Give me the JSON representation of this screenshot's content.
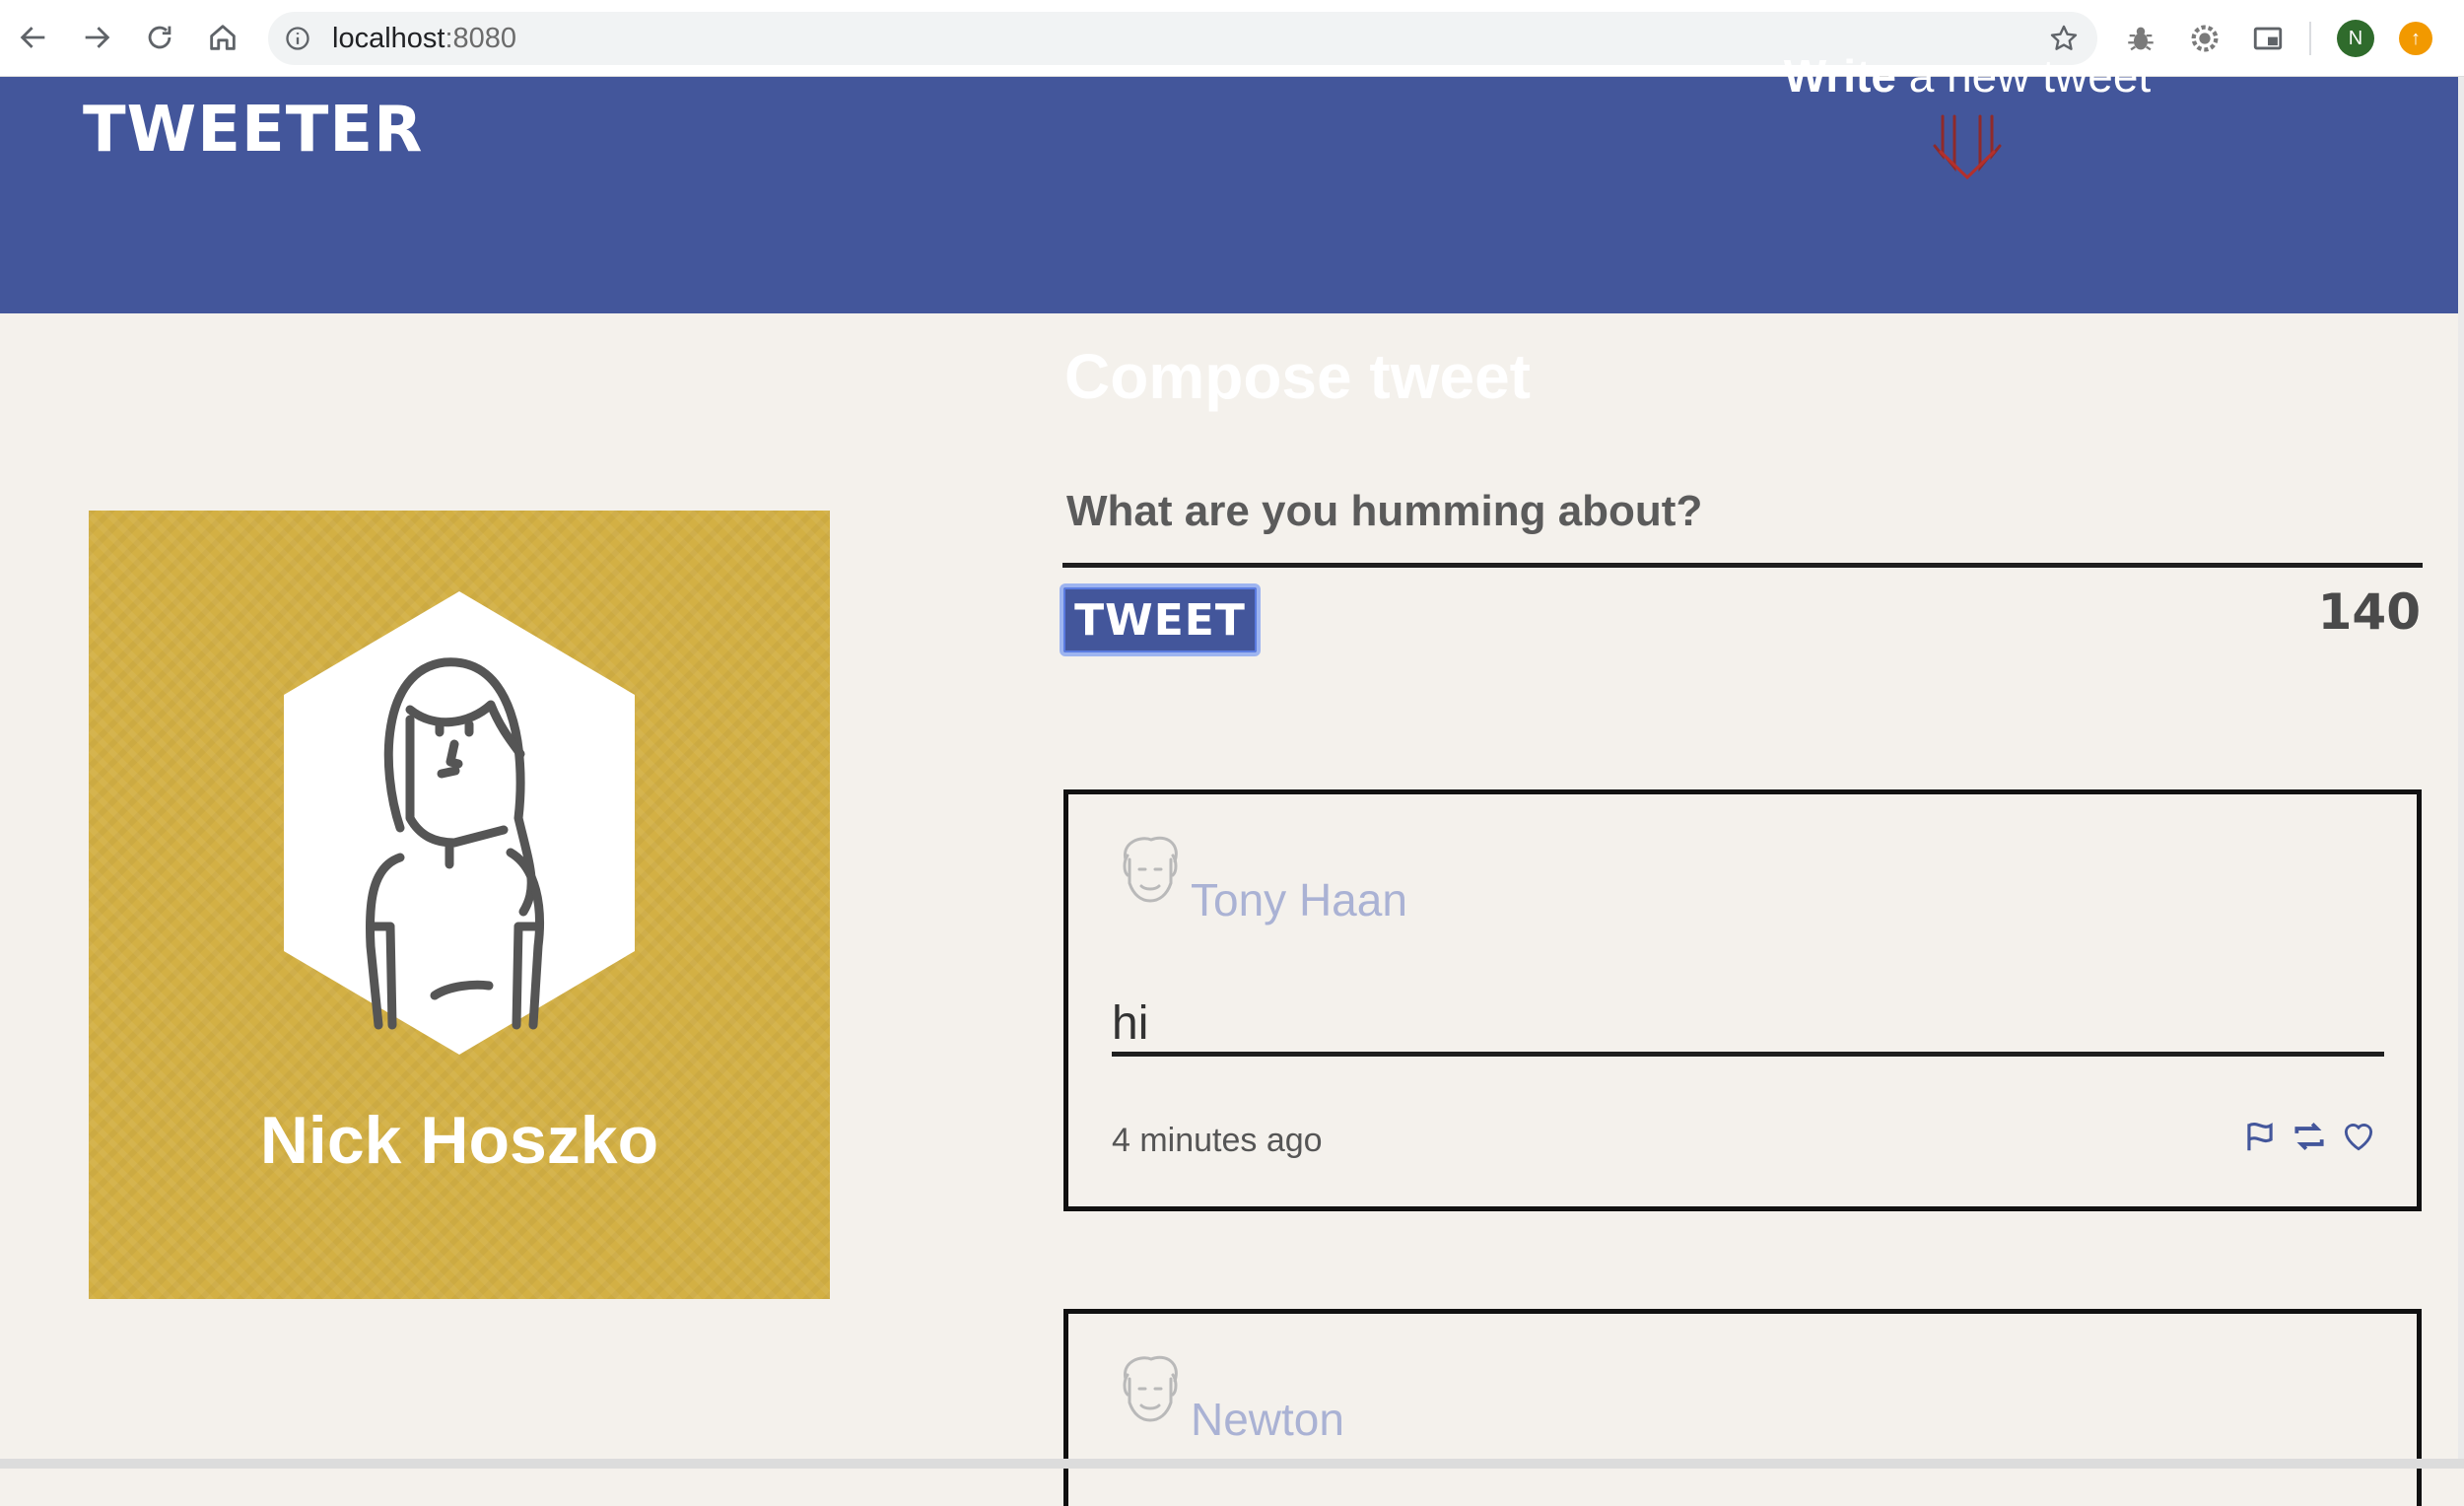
{
  "browser": {
    "url_host": "localhost",
    "url_port": ":8080",
    "profile_initial": "N"
  },
  "header": {
    "brand": "TWEETER",
    "write_bold": "Write",
    "write_rest": " a new tweet"
  },
  "profile": {
    "name": "Nick Hoszko"
  },
  "compose": {
    "title": "Compose tweet",
    "prompt": "What are you humming about?",
    "button_label": "TWEET",
    "counter": "140"
  },
  "tweets": [
    {
      "author": "Tony Haan",
      "text": "hi",
      "time": "4 minutes ago"
    },
    {
      "author": "Newton"
    }
  ],
  "colors": {
    "header_bg": "#43569b",
    "page_bg": "#f4f1ec",
    "card_bg": "#d3b044",
    "author_text": "#aab2d4"
  }
}
